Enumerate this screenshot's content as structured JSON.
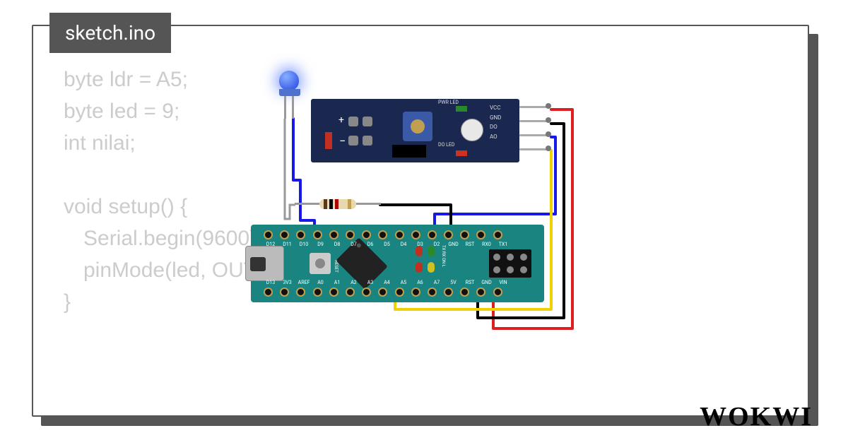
{
  "tab": {
    "filename": "sketch.ino"
  },
  "code": {
    "line1": "byte ldr = A5;",
    "line2": "byte led = 9;",
    "line3": "int nilai;",
    "line4": "",
    "line5": "void setup() {",
    "line6": "Serial.begin(9600);",
    "line7": "pinMode(led, OUTPUT);",
    "line8": "}"
  },
  "logo": "WOKWI",
  "ldr_module": {
    "plus": "+",
    "minus": "−",
    "pwr_led": "PWR\nLED",
    "do_led": "DO\nLED",
    "pins": [
      "VCC",
      "GND",
      "DO",
      "AO"
    ]
  },
  "nano": {
    "top_pins": [
      "D12",
      "D11",
      "D10",
      "D9",
      "D8",
      "D7",
      "D6",
      "D5",
      "D4",
      "D3",
      "D2",
      "GND",
      "RST",
      "RX0",
      "TX1"
    ],
    "bottom_pins": [
      "D13",
      "3V3",
      "AREF",
      "A0",
      "A1",
      "A2",
      "A3",
      "A4",
      "A5",
      "A6",
      "A7",
      "5V",
      "RST",
      "GND",
      "VIN"
    ],
    "led_labels": "TX RX\nON  L",
    "reset": "RESET"
  },
  "colors": {
    "wire_red": "#de1f1f",
    "wire_black": "#000000",
    "wire_yellow": "#f0d000",
    "wire_blue": "#1818e8",
    "led_blue": "#3050ff"
  }
}
